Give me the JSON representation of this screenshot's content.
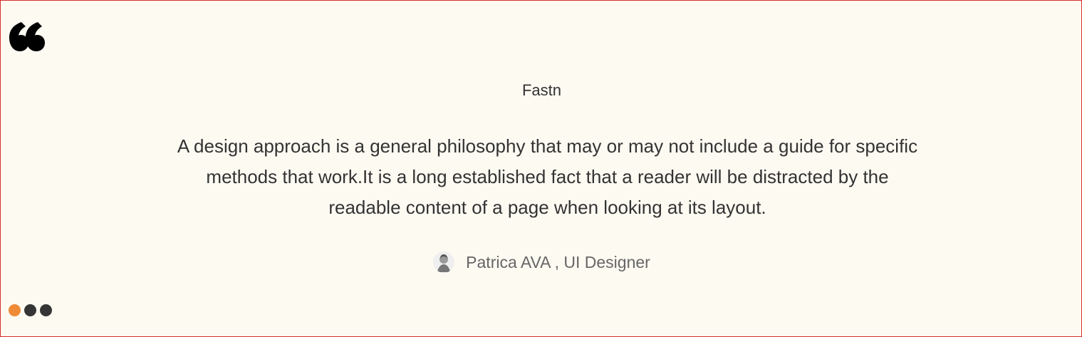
{
  "testimonial": {
    "brand": "Fastn",
    "quote": "A design approach is a general philosophy that may or may not include a guide for specific methods that work.It is a long established fact that a reader will be distracted by the readable content of a page when looking at its layout.",
    "author": "Patrica AVA , UI Designer",
    "quote_icon": "quote-icon",
    "avatar_icon": "avatar-icon"
  },
  "carousel": {
    "active_index": 1,
    "dot_count": 3,
    "active_color": "#ef8a36",
    "inactive_color": "#353535"
  },
  "colors": {
    "border": "#d92b2b",
    "background": "#fdfaf2",
    "text": "#333333",
    "author_text": "#666666"
  }
}
